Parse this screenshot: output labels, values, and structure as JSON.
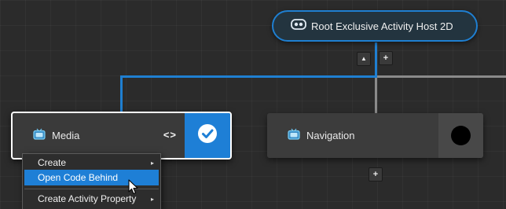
{
  "root_node": {
    "label": "Root Exclusive Activity Host 2D",
    "icon": "activity-host-icon",
    "buttons": [
      {
        "label": "▲",
        "icon": "collapse-up-icon"
      },
      {
        "label": "+",
        "icon": "add-child-icon"
      }
    ]
  },
  "media_node": {
    "label": "Media",
    "icon": "tv-icon",
    "code_label": "<>",
    "state": "checked"
  },
  "navigation_node": {
    "label": "Navigation",
    "icon": "tv-icon",
    "add_button": "+"
  },
  "context_menu": {
    "items": [
      {
        "label": "Create",
        "submenu": "▸",
        "selected": false
      },
      {
        "label": "Open Code Behind",
        "submenu": "",
        "selected": true
      },
      {
        "label": "Create Activity Property",
        "submenu": "▸",
        "selected": false
      }
    ]
  },
  "colors": {
    "accent": "#1e7fd6",
    "canvas": "#2b2b2b",
    "node": "#3a3a3a"
  }
}
